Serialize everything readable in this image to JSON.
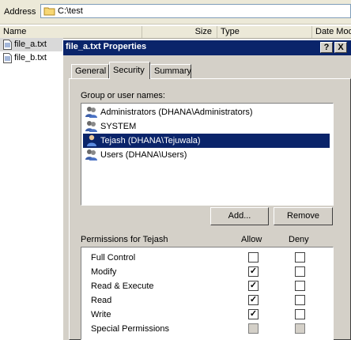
{
  "address": {
    "label": "Address",
    "path": "C:\\test"
  },
  "columns": {
    "name": "Name",
    "size": "Size",
    "type": "Type",
    "date": "Date Mod"
  },
  "files": [
    "file_a.txt",
    "file_b.txt"
  ],
  "dialog": {
    "title": "file_a.txt Properties",
    "help": "?",
    "close": "X",
    "tabs": [
      "General",
      "Security",
      "Summary"
    ],
    "group_label": "Group or user names:",
    "users": [
      "Administrators (DHANA\\Administrators)",
      "SYSTEM",
      "Tejash (DHANA\\Tejuwala)",
      "Users (DHANA\\Users)"
    ],
    "add_button": "Add...",
    "remove_button": "Remove",
    "permissions_label": "Permissions for Tejash",
    "allow_header": "Allow",
    "deny_header": "Deny",
    "permissions": [
      {
        "name": "Full Control",
        "allow": false,
        "deny": false,
        "disabled": false
      },
      {
        "name": "Modify",
        "allow": true,
        "deny": false,
        "disabled": false
      },
      {
        "name": "Read & Execute",
        "allow": true,
        "deny": false,
        "disabled": false
      },
      {
        "name": "Read",
        "allow": true,
        "deny": false,
        "disabled": false
      },
      {
        "name": "Write",
        "allow": true,
        "deny": false,
        "disabled": false
      },
      {
        "name": "Special Permissions",
        "allow": false,
        "deny": false,
        "disabled": true
      }
    ]
  },
  "colors": {
    "titlebar": "#0a246a",
    "selection": "#0a246a",
    "face": "#d4d0c8"
  }
}
